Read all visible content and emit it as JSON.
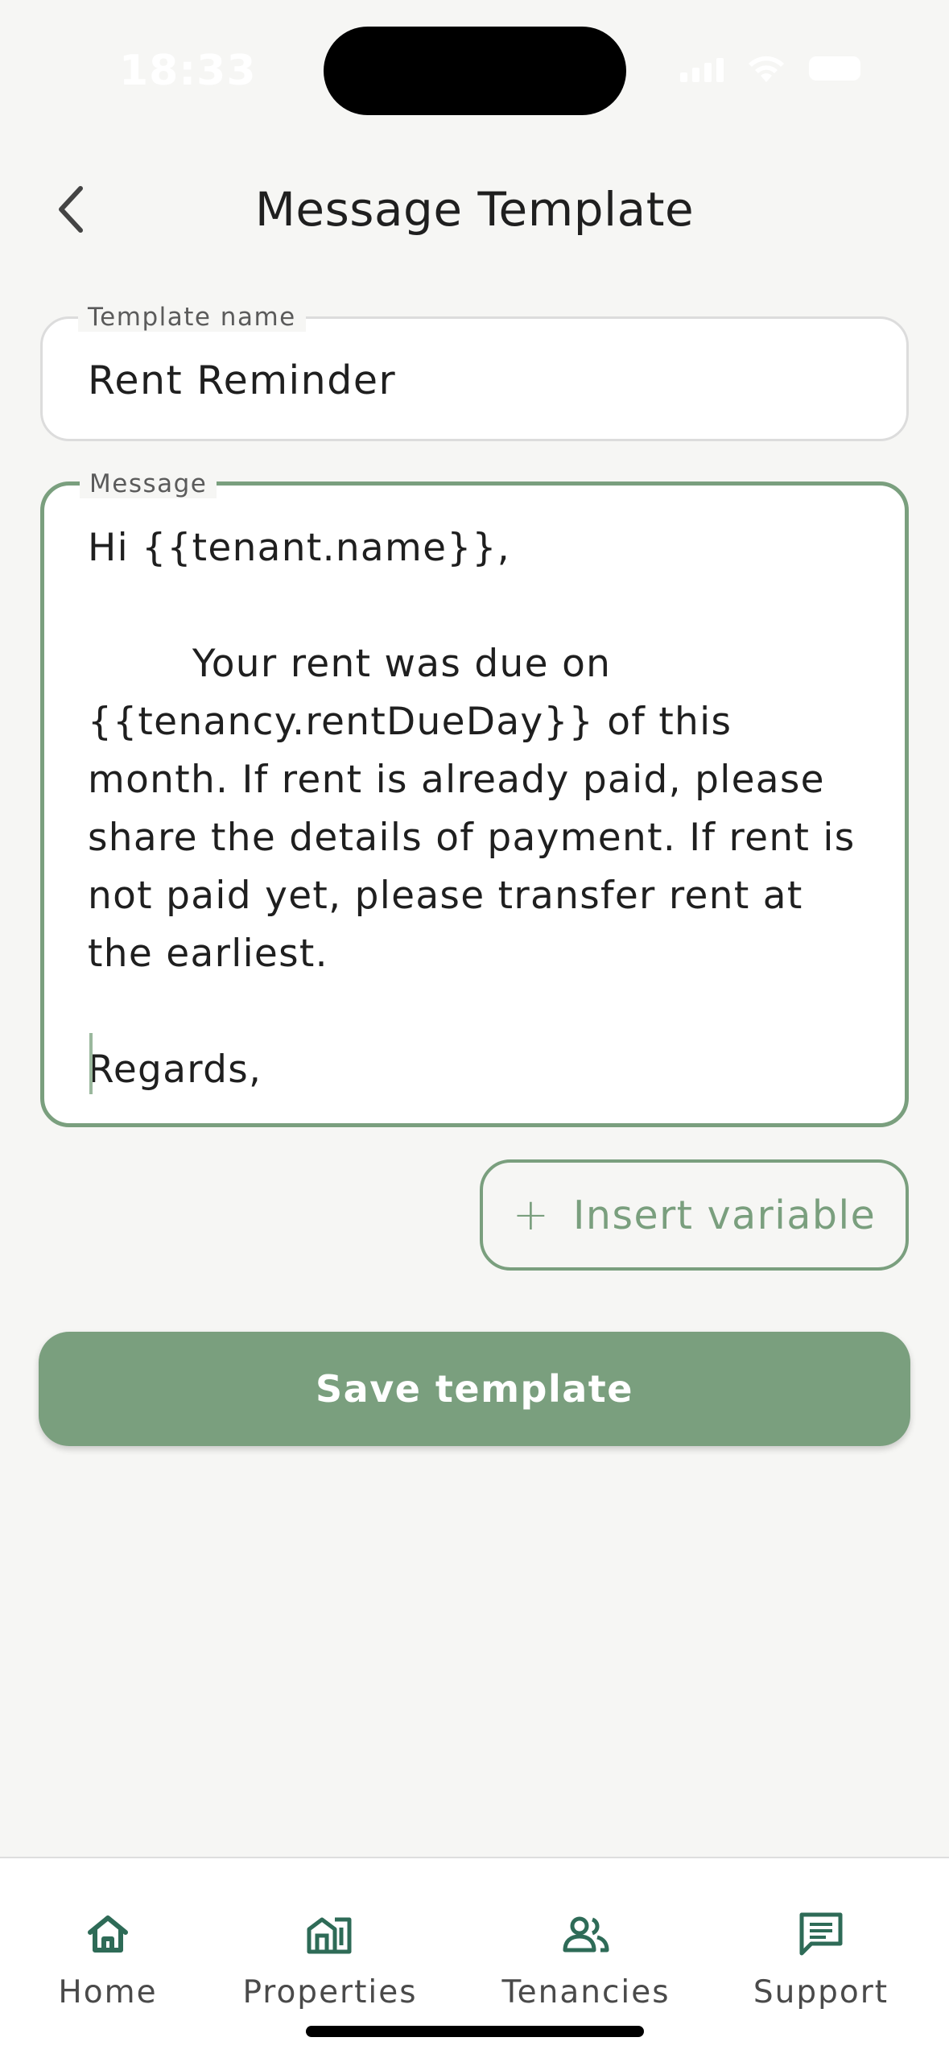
{
  "status_bar": {
    "time": "18:33"
  },
  "header": {
    "title": "Message Template",
    "back_icon": "chevron-left-icon"
  },
  "form": {
    "template_name": {
      "label": "Template name",
      "value": "Rent Reminder"
    },
    "message": {
      "label": "Message",
      "value": "Hi {{tenant.name}},\n\n        Your rent was due on {{tenancy.rentDueDay}} of this month. If rent is already paid, please share the details of payment. If rent is not paid yet, please transfer rent at the earliest.\n\nRegards,"
    },
    "insert_variable": {
      "icon": "plus-icon",
      "label": "Insert variable"
    },
    "save_label": "Save template"
  },
  "nav": {
    "items": [
      {
        "label": "Home",
        "icon": "home-icon"
      },
      {
        "label": "Properties",
        "icon": "buildings-icon"
      },
      {
        "label": "Tenancies",
        "icon": "people-icon"
      },
      {
        "label": "Support",
        "icon": "chat-icon"
      }
    ]
  },
  "colors": {
    "accent": "#7a9f7e",
    "nav_icon": "#2e6b57",
    "background": "#f6f6f4"
  }
}
